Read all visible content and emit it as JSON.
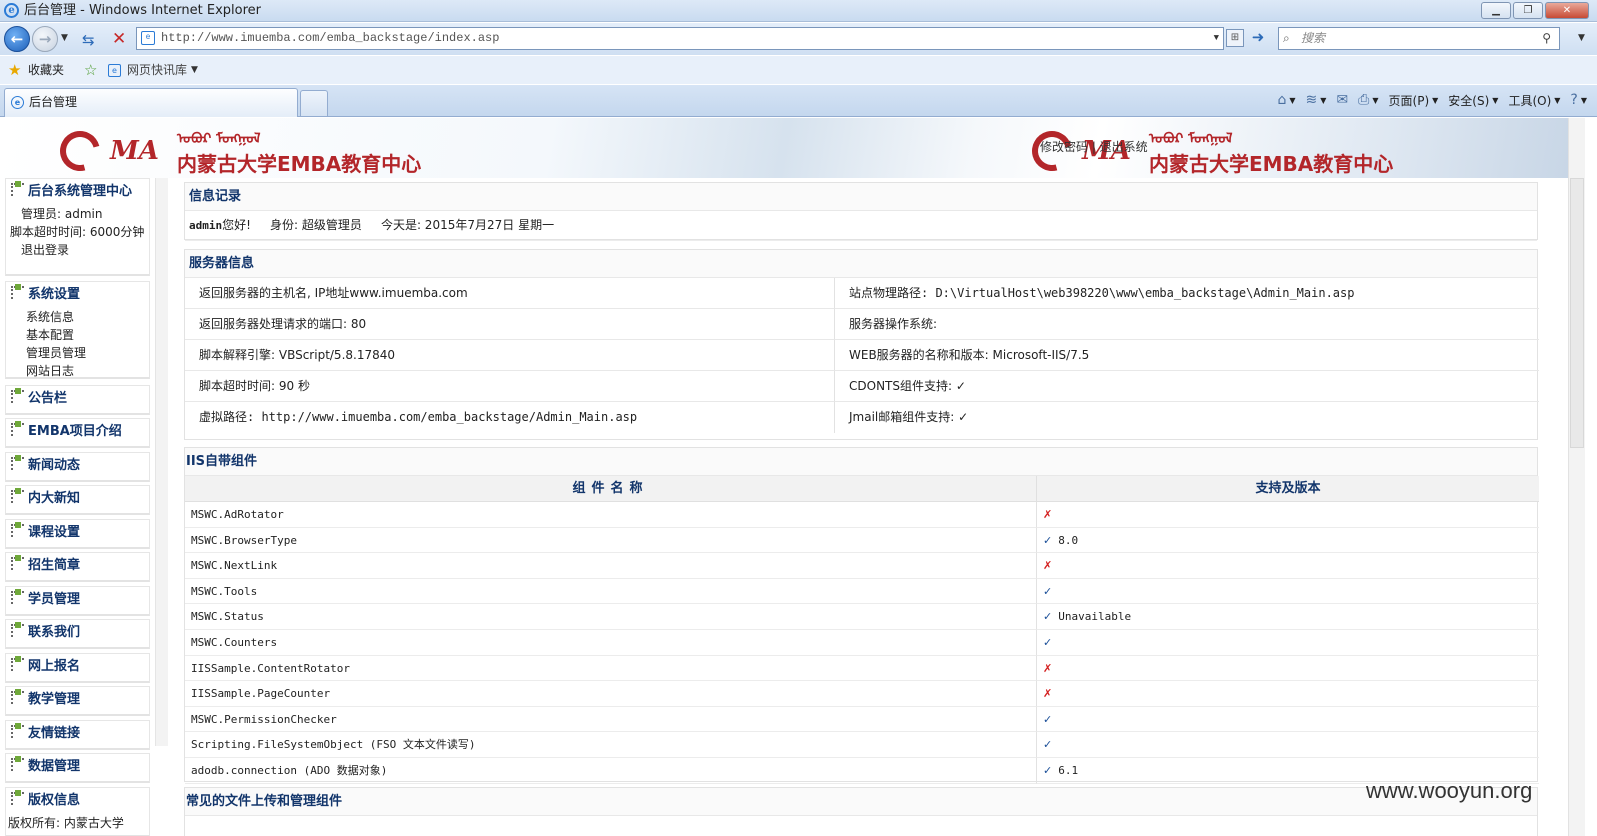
{
  "window": {
    "title": "后台管理 - Windows Internet Explorer"
  },
  "address": {
    "url": "http://www.imuemba.com/emba_backstage/index.asp",
    "search_placeholder": "搜索"
  },
  "favorites": {
    "label": "收藏夹",
    "feed_label": "网页快讯库"
  },
  "tab": {
    "label": "后台管理"
  },
  "commands": [
    "页面(P)",
    "安全(S)",
    "工具(O)"
  ],
  "banner": {
    "ma": "MA",
    "org": "内蒙古大学EMBA教育中心",
    "mongol": "ᠣᠪᠤᠷ ᠮᠣᠩᠭᠣᠯ",
    "links": "修改密码 | 退出系统"
  },
  "sidebar": {
    "center": {
      "title": "后台系统管理中心",
      "admin": "管理员: admin",
      "timeout": "脚本超时时间: 6000分钟",
      "logout": "退出登录"
    },
    "settings": {
      "title": "系统设置",
      "items": [
        "系统信息",
        "基本配置",
        "管理员管理",
        "网站日志"
      ]
    },
    "items": [
      "公告栏",
      "EMBA项目介绍",
      "新闻动态",
      "内大新知",
      "课程设置",
      "招生简章",
      "学员管理",
      "联系我们",
      "网上报名",
      "教学管理",
      "友情链接",
      "数据管理",
      "版权信息"
    ],
    "copyright": "版权所有: 内蒙古大学"
  },
  "info": {
    "title": "信息记录",
    "user": "admin",
    "greeting": "您好!",
    "role": "身份: 超级管理员",
    "today": "今天是: 2015年7月27日 星期一"
  },
  "server": {
    "title": "服务器信息",
    "cells": [
      "返回服务器的主机名, IP地址www.imuemba.com",
      "站点物理路径: D:\\VirtualHost\\web398220\\www\\emba_backstage\\Admin_Main.asp",
      "返回服务器处理请求的端口: 80",
      "服务器操作系统:",
      "脚本解释引擎: VBScript/5.8.17840",
      "WEB服务器的名称和版本: Microsoft-IIS/7.5",
      "脚本超时时间: 90 秒",
      "CDONTS组件支持: ✓",
      "虚拟路径: http://www.imuemba.com/emba_backstage/Admin_Main.asp",
      "Jmail邮箱组件支持: ✓"
    ]
  },
  "iis": {
    "title": "IIS自带组件",
    "col_name": "组件名称",
    "col_support": "支持及版本",
    "rows": [
      {
        "name": "MSWC.AdRotator",
        "mark": "✗",
        "ok": false,
        "ver": ""
      },
      {
        "name": "MSWC.BrowserType",
        "mark": "✓",
        "ok": true,
        "ver": "8.0"
      },
      {
        "name": "MSWC.NextLink",
        "mark": "✗",
        "ok": false,
        "ver": ""
      },
      {
        "name": "MSWC.Tools",
        "mark": "✓",
        "ok": true,
        "ver": ""
      },
      {
        "name": "MSWC.Status",
        "mark": "✓",
        "ok": true,
        "ver": "Unavailable"
      },
      {
        "name": "MSWC.Counters",
        "mark": "✓",
        "ok": true,
        "ver": ""
      },
      {
        "name": "IISSample.ContentRotator",
        "mark": "✗",
        "ok": false,
        "ver": ""
      },
      {
        "name": "IISSample.PageCounter",
        "mark": "✗",
        "ok": false,
        "ver": ""
      },
      {
        "name": "MSWC.PermissionChecker",
        "mark": "✓",
        "ok": true,
        "ver": ""
      },
      {
        "name": "Scripting.FileSystemObject (FSO 文本文件读写)",
        "mark": "✓",
        "ok": true,
        "ver": ""
      },
      {
        "name": "adodb.connection (ADO 数据对象)",
        "mark": "✓",
        "ok": true,
        "ver": "6.1"
      }
    ]
  },
  "upload": {
    "title": "常见的文件上传和管理组件"
  },
  "watermark": "www.wooyun.org"
}
